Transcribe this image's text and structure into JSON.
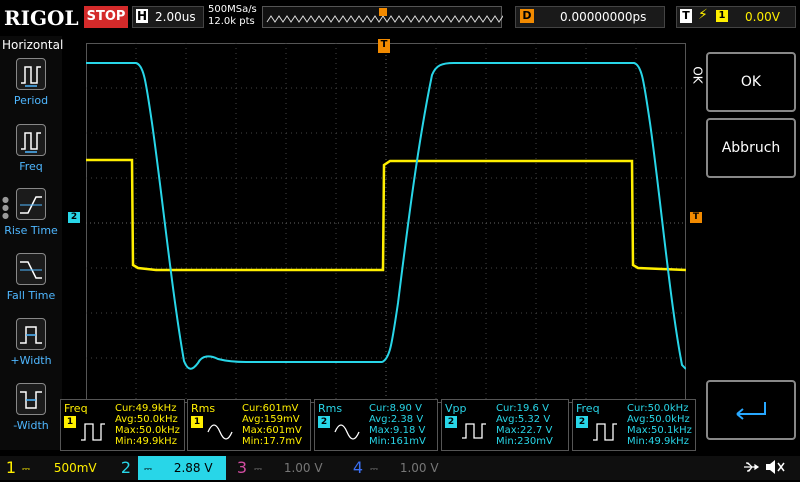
{
  "topbar": {
    "logo": "RIGOL",
    "run_state": "STOP",
    "horizontal_letter": "H",
    "timebase": "2.00us",
    "sample_rate": "500MSa/s",
    "points": "12.0k pts",
    "delay_letter": "D",
    "delay": "0.00000000ps",
    "trigger_letter": "T",
    "trigger_source": "1",
    "trigger_level": "0.00V"
  },
  "left_menu": {
    "title": "Horizontal",
    "items": [
      {
        "label": "Period",
        "icon": "period-icon"
      },
      {
        "label": "Freq",
        "icon": "frequency-icon"
      },
      {
        "label": "Rise Time",
        "icon": "rise-time-icon"
      },
      {
        "label": "Fall Time",
        "icon": "fall-time-icon"
      },
      {
        "label": "+Width",
        "icon": "positive-width-icon"
      },
      {
        "label": "-Width",
        "icon": "negative-width-icon"
      }
    ]
  },
  "right_menu": {
    "close_glyph": "OK",
    "ok_label": "OK",
    "cancel_label": "Abbruch",
    "enter_icon": "enter-arrow-icon"
  },
  "markers": {
    "ch2_marker": "2",
    "trigger_level_marker": "T",
    "trigger_pos_marker": "T"
  },
  "measurements": [
    {
      "name": "Freq",
      "channel": "1",
      "cur": "Cur:49.9kHz",
      "avg": "Avg:50.0kHz",
      "max": "Max:50.0kHz",
      "min": "Min:49.9kHz"
    },
    {
      "name": "Rms",
      "channel": "1",
      "cur": "Cur:601mV",
      "avg": "Avg:159mV",
      "max": "Max:601mV",
      "min": "Min:17.7mV"
    },
    {
      "name": "Rms",
      "channel": "2",
      "cur": "Cur:8.90 V",
      "avg": "Avg:2.38 V",
      "max": "Max:9.18 V",
      "min": "Min:161mV"
    },
    {
      "name": "Vpp",
      "channel": "2",
      "cur": "Cur:19.6 V",
      "avg": "Avg:5.32 V",
      "max": "Max:22.7 V",
      "min": "Min:230mV"
    },
    {
      "name": "Freq",
      "channel": "2",
      "cur": "Cur:50.0kHz",
      "avg": "Avg:50.0kHz",
      "max": "Max:50.1kHz",
      "min": "Min:49.9kHz"
    }
  ],
  "channels": [
    {
      "num": "1",
      "scale": "500mV",
      "color": "#ffef00"
    },
    {
      "num": "2",
      "scale": "2.88 V",
      "color": "#28d6e8"
    },
    {
      "num": "3",
      "scale": "1.00 V",
      "color": "#d04ca0"
    },
    {
      "num": "4",
      "scale": "1.00 V",
      "color": "#3a6ef0"
    }
  ],
  "colors": {
    "ch1": "#ffef00",
    "ch2": "#28d6e8",
    "trigger": "#f28a00",
    "stop": "#d42a2a",
    "menu_label": "#4fb7ff"
  }
}
